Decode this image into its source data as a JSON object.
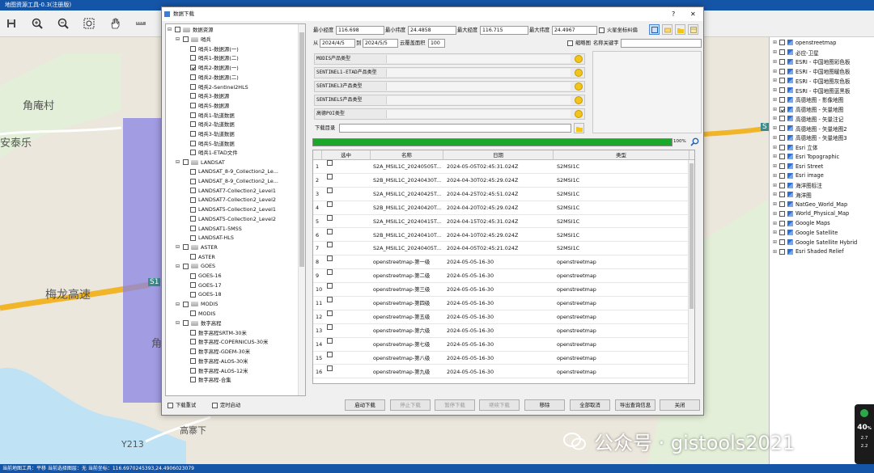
{
  "app": {
    "title": "地图资源工具-0.3(注册版)"
  },
  "toolbar": {
    "icons": [
      "save-icon",
      "zoom-in-icon",
      "zoom-out-icon",
      "zoom-extent-icon",
      "pan-hand-icon",
      "measure-ruler-icon"
    ]
  },
  "map": {
    "labels": [
      "角庵村",
      "安泰乐",
      "梅龙高速",
      "S1",
      "角",
      "S",
      "高寨下",
      "Y213"
    ],
    "colors": {
      "road": "#f1b52a",
      "river": "#bfe3f5",
      "selection": "#8a83e6",
      "badge": "#3c8a8a"
    }
  },
  "dialog": {
    "title": "数据下载",
    "help": "?",
    "close": "✕",
    "tree": {
      "root": "数据资源",
      "nodes": [
        {
          "label": "哨兵",
          "level": 1,
          "checked": false,
          "expander": "⊟"
        },
        {
          "label": "哨兵1-数据源(一)",
          "level": 2,
          "checked": false
        },
        {
          "label": "哨兵1-数据源(二)",
          "level": 2,
          "checked": false
        },
        {
          "label": "哨兵2-数据源(一)",
          "level": 2,
          "checked": true
        },
        {
          "label": "哨兵2-数据源(二)",
          "level": 2,
          "checked": false
        },
        {
          "label": "哨兵2-Sentinel2HLS",
          "level": 2,
          "checked": false
        },
        {
          "label": "哨兵3-数据源",
          "level": 2,
          "checked": false
        },
        {
          "label": "哨兵5-数据源",
          "level": 2,
          "checked": false
        },
        {
          "label": "哨兵1-轨道数据",
          "level": 2,
          "checked": false
        },
        {
          "label": "哨兵2-轨道数据",
          "level": 2,
          "checked": false
        },
        {
          "label": "哨兵3-轨道数据",
          "level": 2,
          "checked": false
        },
        {
          "label": "哨兵5-轨道数据",
          "level": 2,
          "checked": false
        },
        {
          "label": "哨兵1-ETAD文件",
          "level": 2,
          "checked": false
        },
        {
          "label": "LANDSAT",
          "level": 1,
          "checked": false,
          "expander": "⊟"
        },
        {
          "label": "LANDSAT_8-9_Collection2_Le...",
          "level": 2,
          "checked": false
        },
        {
          "label": "LANDSAT_8-9_Collection2_Le...",
          "level": 2,
          "checked": false
        },
        {
          "label": "LANDSAT7-Collection2_Level1",
          "level": 2,
          "checked": false
        },
        {
          "label": "LANDSAT7-Collection2_Level2",
          "level": 2,
          "checked": false
        },
        {
          "label": "LANDSAT5-Collection2_Level1",
          "level": 2,
          "checked": false
        },
        {
          "label": "LANDSAT5-Collection2_Level2",
          "level": 2,
          "checked": false
        },
        {
          "label": "LANDSAT1-5MSS",
          "level": 2,
          "checked": false
        },
        {
          "label": "LANDSAT-HLS",
          "level": 2,
          "checked": false
        },
        {
          "label": "ASTER",
          "level": 1,
          "checked": false,
          "expander": "⊟"
        },
        {
          "label": "ASTER",
          "level": 2,
          "checked": false
        },
        {
          "label": "GOES",
          "level": 1,
          "checked": false,
          "expander": "⊟"
        },
        {
          "label": "GOES-16",
          "level": 2,
          "checked": false
        },
        {
          "label": "GOES-17",
          "level": 2,
          "checked": false
        },
        {
          "label": "GOES-18",
          "level": 2,
          "checked": false
        },
        {
          "label": "MODIS",
          "level": 1,
          "checked": false,
          "expander": "⊟"
        },
        {
          "label": "MODIS",
          "level": 2,
          "checked": false
        },
        {
          "label": "数字高程",
          "level": 1,
          "checked": false,
          "expander": "⊟"
        },
        {
          "label": "数字高程SRTM-30米",
          "level": 2,
          "checked": false
        },
        {
          "label": "数字高程-COPERNICUS-30米",
          "level": 2,
          "checked": false
        },
        {
          "label": "数字高程-GDEM-30米",
          "level": 2,
          "checked": false
        },
        {
          "label": "数字高程-ALOS-30米",
          "level": 2,
          "checked": false
        },
        {
          "label": "数字高程-ALOS-12米",
          "level": 2,
          "checked": false
        },
        {
          "label": "数字高程-合集",
          "level": 2,
          "checked": false
        }
      ]
    },
    "extent": {
      "min_lon_label": "最小经度",
      "min_lon": "116.698",
      "min_lat_label": "最小纬度",
      "min_lat": "24.4858",
      "max_lon_label": "最大经度",
      "max_lon": "116.715",
      "max_lat_label": "最大纬度",
      "max_lat": "24.4967",
      "mars_label": "火星坐标纠偏"
    },
    "date": {
      "from_label": "从",
      "from": "2024/4/5",
      "to_label": "到",
      "to": "2024/5/5",
      "cloud_label": "云覆盖面积",
      "cloud": "100",
      "thumb_label": "缩略图",
      "keyword_label": "名称关键字",
      "keyword": ""
    },
    "product_types": [
      "MODIS产品类型",
      "SENTINEL1-ETAD产品类型",
      "SENTINEL3产品类型",
      "SENTINEL5产品类型",
      "高德POI类型"
    ],
    "download_dir_label": "下载目录",
    "download_dir": "",
    "progress": {
      "value": 1.0,
      "label": "100%"
    },
    "table": {
      "columns": [
        "选中",
        "名称",
        "日期",
        "类型"
      ],
      "rows": [
        {
          "n": "1",
          "name": "S2A_MSIL1C_20240505T...",
          "date": "2024-05-05T02:45:31.024Z",
          "type": "S2MSI1C",
          "extra": "7"
        },
        {
          "n": "2",
          "name": "S2B_MSIL1C_20240430T...",
          "date": "2024-04-30T02:45:29.024Z",
          "type": "S2MSI1C",
          "extra": "5"
        },
        {
          "n": "3",
          "name": "S2A_MSIL1C_20240425T...",
          "date": "2024-04-25T02:45:51.024Z",
          "type": "S2MSI1C",
          "extra": "7"
        },
        {
          "n": "4",
          "name": "S2B_MSIL1C_20240420T...",
          "date": "2024-04-20T02:45:29.024Z",
          "type": "S2MSI1C",
          "extra": "6"
        },
        {
          "n": "5",
          "name": "S2A_MSIL1C_20240415T...",
          "date": "2024-04-15T02:45:31.024Z",
          "type": "S2MSI1C",
          "extra": "7"
        },
        {
          "n": "6",
          "name": "S2B_MSIL1C_20240410T...",
          "date": "2024-04-10T02:45:29.024Z",
          "type": "S2MSI1C",
          "extra": "5"
        },
        {
          "n": "7",
          "name": "S2A_MSIL1C_20240405T...",
          "date": "2024-04-05T02:45:21.024Z",
          "type": "S2MSI1C",
          "extra": "7"
        },
        {
          "n": "8",
          "name": "openstreetmap-第一级",
          "date": "2024-05-05-16-30",
          "type": "openstreetmap",
          "extra": "F"
        },
        {
          "n": "9",
          "name": "openstreetmap-第二级",
          "date": "2024-05-05-16-30",
          "type": "openstreetmap",
          "extra": "F"
        },
        {
          "n": "10",
          "name": "openstreetmap-第三级",
          "date": "2024-05-05-16-30",
          "type": "openstreetmap",
          "extra": "F"
        },
        {
          "n": "11",
          "name": "openstreetmap-第四级",
          "date": "2024-05-05-16-30",
          "type": "openstreetmap",
          "extra": "F"
        },
        {
          "n": "12",
          "name": "openstreetmap-第五级",
          "date": "2024-05-05-16-30",
          "type": "openstreetmap",
          "extra": "F"
        },
        {
          "n": "13",
          "name": "openstreetmap-第六级",
          "date": "2024-05-05-16-30",
          "type": "openstreetmap",
          "extra": "F"
        },
        {
          "n": "14",
          "name": "openstreetmap-第七级",
          "date": "2024-05-05-16-30",
          "type": "openstreetmap",
          "extra": "F"
        },
        {
          "n": "15",
          "name": "openstreetmap-第八级",
          "date": "2024-05-05-16-30",
          "type": "openstreetmap",
          "extra": "F"
        },
        {
          "n": "16",
          "name": "openstreetmap-第九级",
          "date": "2024-05-05-16-30",
          "type": "openstreetmap",
          "extra": "F"
        }
      ]
    },
    "footer": {
      "retry": "下载重试",
      "timer": "定时启动",
      "buttons": [
        "启动下载",
        "停止下载",
        "暂停下载",
        "继续下载",
        "移除",
        "全部取消",
        "导出查询信息",
        "关闭"
      ],
      "disabled": [
        false,
        true,
        true,
        true,
        false,
        false,
        false,
        false
      ]
    }
  },
  "layers": [
    {
      "label": "openstreetmap",
      "checked": false
    },
    {
      "label": "必应-卫星",
      "checked": false
    },
    {
      "label": "ESRI - 中国地图彩色板",
      "checked": false
    },
    {
      "label": "ESRI - 中国地图暖色板",
      "checked": false
    },
    {
      "label": "ESRI - 中国地图灰色板",
      "checked": false
    },
    {
      "label": "ESRI - 中国地图蓝黑板",
      "checked": false
    },
    {
      "label": "高德地图 - 影像地图",
      "checked": false
    },
    {
      "label": "高德地图 - 矢量地图",
      "checked": true
    },
    {
      "label": "高德地图 - 矢量注记",
      "checked": false
    },
    {
      "label": "高德地图 - 矢量地图2",
      "checked": false
    },
    {
      "label": "高德地图 - 矢量地图3",
      "checked": false
    },
    {
      "label": "Esri 立体",
      "checked": false
    },
    {
      "label": "Esri Topographic",
      "checked": false
    },
    {
      "label": "Esri Street",
      "checked": false
    },
    {
      "label": "Esri image",
      "checked": false
    },
    {
      "label": "海洋图标注",
      "checked": false
    },
    {
      "label": "海洋图",
      "checked": false
    },
    {
      "label": "NatGeo_World_Map",
      "checked": false
    },
    {
      "label": "World_Physical_Map",
      "checked": false
    },
    {
      "label": "Google Maps",
      "checked": false
    },
    {
      "label": "Google Satellite",
      "checked": false
    },
    {
      "label": "Google Satellite Hybrid",
      "checked": false
    },
    {
      "label": "Esri Shaded Relief",
      "checked": false
    }
  ],
  "status": {
    "text": "当前地图工具：平移  当前选择图层：无  当前坐标：116.6970245393,24.4906023079"
  },
  "watermark": "公众号 · gistools2021",
  "widget": {
    "value": "40",
    "unit": "%",
    "up": "2.7",
    "down": "2.2"
  }
}
